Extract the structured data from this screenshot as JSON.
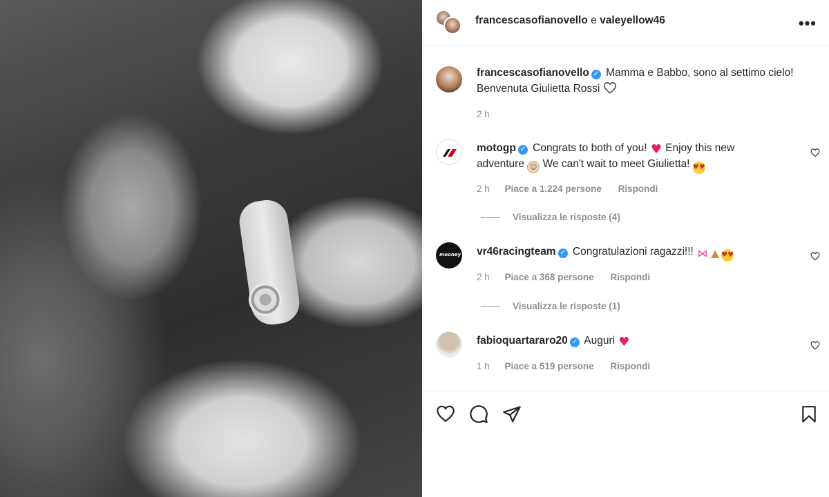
{
  "header": {
    "user1": "francescasofianovello",
    "connector": "e",
    "user2": "valeyellow46",
    "more_label": "•••"
  },
  "caption": {
    "username": "francescasofianovello",
    "text": "Mamma e Babbo, sono al settimo cielo! Benvenuta Giulietta Rossi",
    "time": "2 h"
  },
  "comments": [
    {
      "username": "motogp",
      "text1": "Congrats to both of you!",
      "text2": "Enjoy this new adventure",
      "text3": "We can't wait to meet Giulietta!",
      "time": "2 h",
      "likes": "Piace a 1.224 persone",
      "reply": "Rispondi",
      "view_replies": "Visualizza le risposte (4)"
    },
    {
      "username": "vr46racingteam",
      "text": "Congratulazioni ragazzi!!!",
      "time": "2 h",
      "likes": "Piace a 368 persone",
      "reply": "Rispondi",
      "view_replies": "Visualizza le risposte (1)",
      "avatar_text": "mooney"
    },
    {
      "username": "fabioquartararo20",
      "text": "Auguri",
      "time": "1 h",
      "likes": "Piace a 519 persone",
      "reply": "Rispondi"
    }
  ],
  "icons": [
    "heart-icon",
    "comment-icon",
    "share-icon",
    "bookmark-icon",
    "verified-badge-icon",
    "more-options-icon"
  ],
  "colors": {
    "verified": "#3897f0",
    "heart": "#e0245e",
    "muted": "#8e8e8e"
  }
}
